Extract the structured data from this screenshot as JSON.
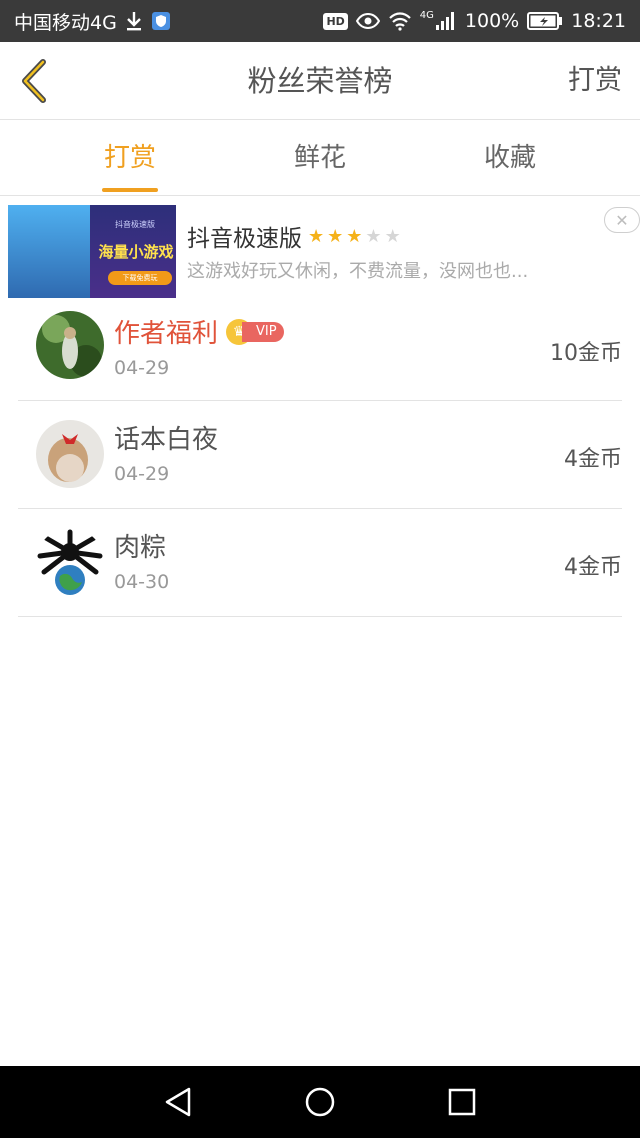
{
  "status_bar": {
    "carrier": "中国移动4G",
    "hd": "HD",
    "network": "4G",
    "battery": "100%",
    "time": "18:21"
  },
  "header": {
    "title": "粉丝荣誉榜",
    "action_label": "打赏"
  },
  "tabs": [
    {
      "label": "打赏",
      "active": true
    },
    {
      "label": "鲜花",
      "active": false
    },
    {
      "label": "收藏",
      "active": false
    }
  ],
  "ad": {
    "thumb_sub": "抖音极速版",
    "thumb_main": "海量小游戏",
    "thumb_button": "下载免费玩",
    "title": "抖音极速版",
    "rating": 3,
    "rating_max": 5,
    "description": "这游戏好玩又休闲，不费流量，没网也也...",
    "close_icon": "close-icon"
  },
  "fans": [
    {
      "name": "作者福利",
      "vip": true,
      "vip_label": "VIP",
      "date": "04-29",
      "coins": "10金币"
    },
    {
      "name": "话本白夜",
      "vip": false,
      "date": "04-29",
      "coins": "4金币"
    },
    {
      "name": "肉粽",
      "vip": false,
      "date": "04-30",
      "coins": "4金币"
    }
  ],
  "colors": {
    "accent": "#f0a020",
    "vip_name": "#e0533a",
    "status_bar": "#3a3a3a"
  }
}
